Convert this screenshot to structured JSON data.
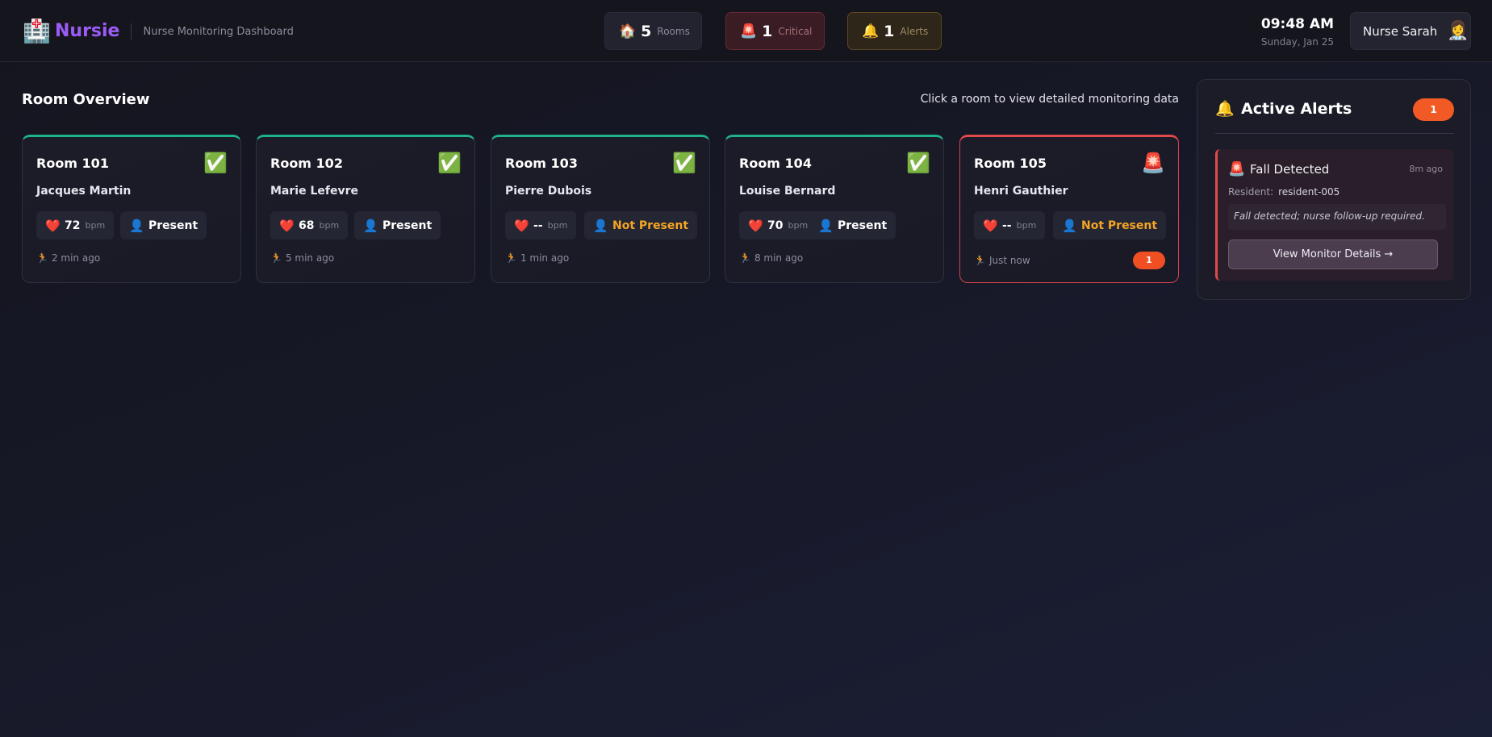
{
  "header": {
    "brand_icon": "hospital-icon",
    "brand_name": "Nursie",
    "subtitle": "Nurse Monitoring Dashboard",
    "stats": [
      {
        "icon": "house-icon",
        "value": "5",
        "label": "Rooms"
      },
      {
        "icon": "siren-icon",
        "value": "1",
        "label": "Critical"
      },
      {
        "icon": "bell-icon",
        "value": "1",
        "label": "Alerts"
      }
    ],
    "time": "09:48 AM",
    "date": "Sunday, Jan 25",
    "user_name": "Nurse Sarah",
    "user_avatar": "nurse-avatar-icon"
  },
  "overview": {
    "title": "Room Overview",
    "hint": "Click a room to view detailed monitoring data"
  },
  "rooms": [
    {
      "room": "Room 101",
      "resident": "Jacques Martin",
      "status_icon": "check-icon",
      "heart_rate": "72",
      "hr_unit": "bpm",
      "presence": "Present",
      "last_activity": "2 min ago",
      "critical": false
    },
    {
      "room": "Room 102",
      "resident": "Marie Lefevre",
      "status_icon": "check-icon",
      "heart_rate": "68",
      "hr_unit": "bpm",
      "presence": "Present",
      "last_activity": "5 min ago",
      "critical": false
    },
    {
      "room": "Room 103",
      "resident": "Pierre Dubois",
      "status_icon": "check-icon",
      "heart_rate": "--",
      "hr_unit": "bpm",
      "presence": "Not Present",
      "last_activity": "1 min ago",
      "critical": false
    },
    {
      "room": "Room 104",
      "resident": "Louise Bernard",
      "status_icon": "check-icon",
      "heart_rate": "70",
      "hr_unit": "bpm",
      "presence": "Present",
      "last_activity": "8 min ago",
      "critical": false
    },
    {
      "room": "Room 105",
      "resident": "Henri Gauthier",
      "status_icon": "siren-icon",
      "heart_rate": "--",
      "hr_unit": "bpm",
      "presence": "Not Present",
      "last_activity": "Just now",
      "critical": true,
      "alert_count": "1"
    }
  ],
  "alerts_panel": {
    "title": "Active Alerts",
    "count": "1",
    "items": [
      {
        "icon": "siren-icon",
        "title": "Fall Detected",
        "time_ago": "8m ago",
        "resident_label": "Resident:",
        "resident_id": "resident-005",
        "message": "Fall detected; nurse follow-up required.",
        "button_label": "View Monitor Details →"
      }
    ]
  },
  "colors": {
    "brand": "#9b5cf6",
    "ok": "#1fb38a",
    "critical": "#e04a4a",
    "warning": "#f5a524",
    "badge": "#f15a24"
  }
}
